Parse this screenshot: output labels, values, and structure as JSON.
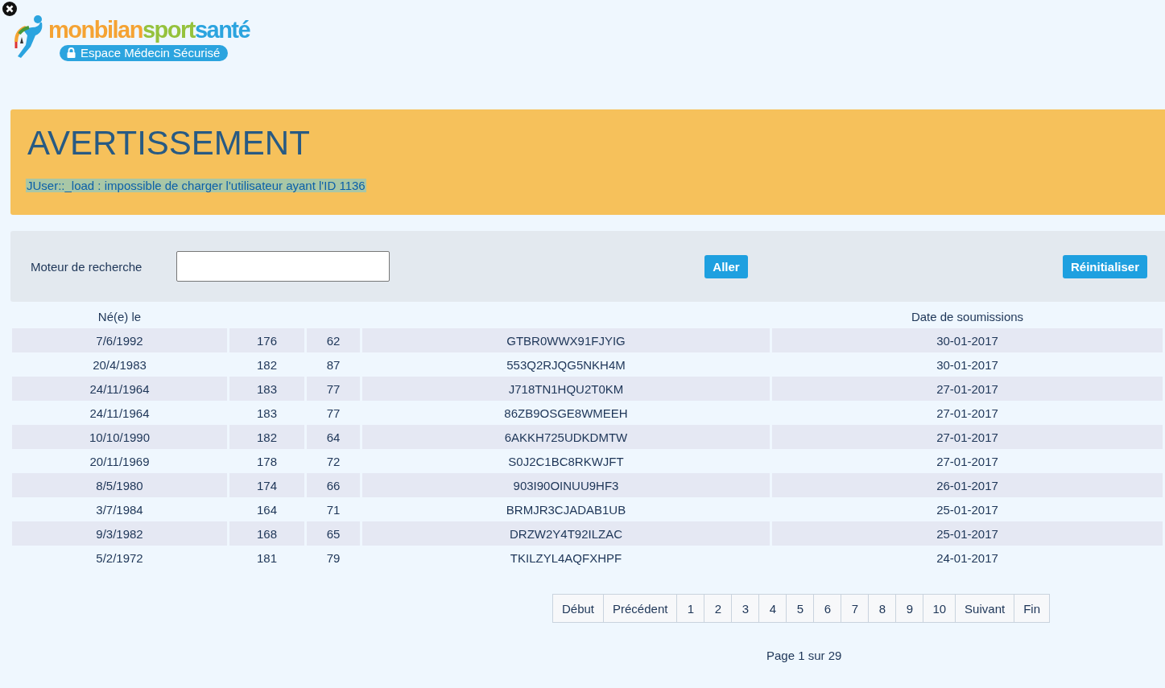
{
  "logo": {
    "parts": [
      {
        "text": "monbilan",
        "color": "#f5a333"
      },
      {
        "text": "sport",
        "color": "#95c23d"
      },
      {
        "text": "santé",
        "color": "#2ba4df"
      }
    ],
    "badge": "Espace Médecin Sécurisé"
  },
  "warning": {
    "title": "AVERTISSEMENT",
    "message": "JUser::_load : impossible de charger l'utilisateur ayant l'ID 1136"
  },
  "search": {
    "label": "Moteur de recherche",
    "go": "Aller",
    "reset": "Réinitialiser"
  },
  "table": {
    "columns": [
      "Né(e) le",
      null,
      null,
      null,
      "Date de soumissions"
    ],
    "rows": [
      [
        "7/6/1992",
        "176",
        "62",
        "GTBR0WWX91FJYIG",
        "30-01-2017"
      ],
      [
        "20/4/1983",
        "182",
        "87",
        "553Q2RJQG5NKH4M",
        "30-01-2017"
      ],
      [
        "24/11/1964",
        "183",
        "77",
        "J718TN1HQU2T0KM",
        "27-01-2017"
      ],
      [
        "24/11/1964",
        "183",
        "77",
        "86ZB9OSGE8WMEEH",
        "27-01-2017"
      ],
      [
        "10/10/1990",
        "182",
        "64",
        "6AKKH725UDKDMTW",
        "27-01-2017"
      ],
      [
        "20/11/1969",
        "178",
        "72",
        "S0J2C1BC8RKWJFT",
        "27-01-2017"
      ],
      [
        "8/5/1980",
        "174",
        "66",
        "903I90OINUU9HF3",
        "26-01-2017"
      ],
      [
        "3/7/1984",
        "164",
        "71",
        "BRMJR3CJADAB1UB",
        "25-01-2017"
      ],
      [
        "9/3/1982",
        "168",
        "65",
        "DRZW2Y4T92ILZAC",
        "25-01-2017"
      ],
      [
        "5/2/1972",
        "181",
        "79",
        "TKILZYL4AQFXHPF",
        "24-01-2017"
      ]
    ]
  },
  "pagination": {
    "buttons": [
      "Début",
      "Précédent",
      "1",
      "2",
      "3",
      "4",
      "5",
      "6",
      "7",
      "8",
      "9",
      "10",
      "Suivant",
      "Fin"
    ],
    "status": "Page 1 sur 29"
  }
}
